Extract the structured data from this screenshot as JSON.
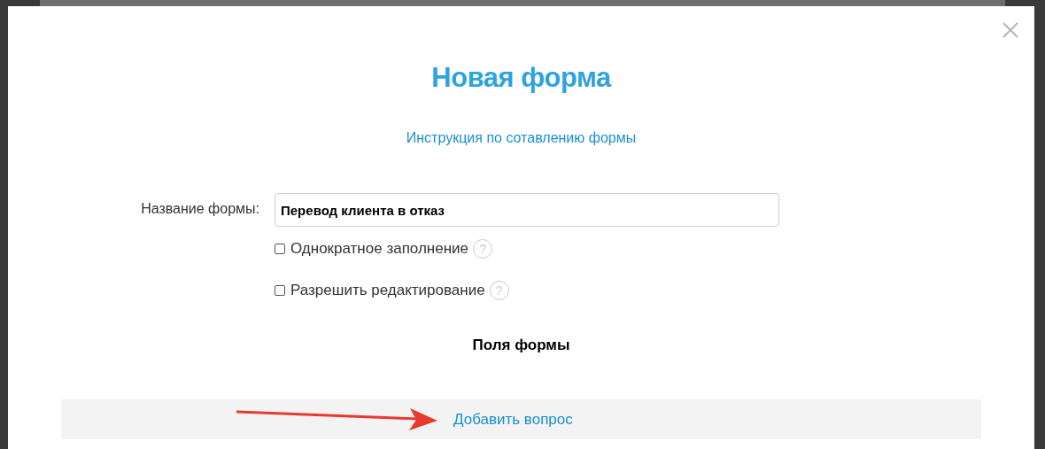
{
  "dialog": {
    "title": "Новая форма",
    "instruction_link": "Инструкция по сотавлению формы",
    "form_name": {
      "label": "Название формы:",
      "value": "Перевод клиента в отказ"
    },
    "options": [
      {
        "label": "Однократное заполнение",
        "checked": false,
        "help": "?"
      },
      {
        "label": "Разрешить редактирование",
        "checked": false,
        "help": "?"
      }
    ],
    "fields_heading": "Поля формы",
    "add_question_link": "Добавить вопрос"
  }
}
